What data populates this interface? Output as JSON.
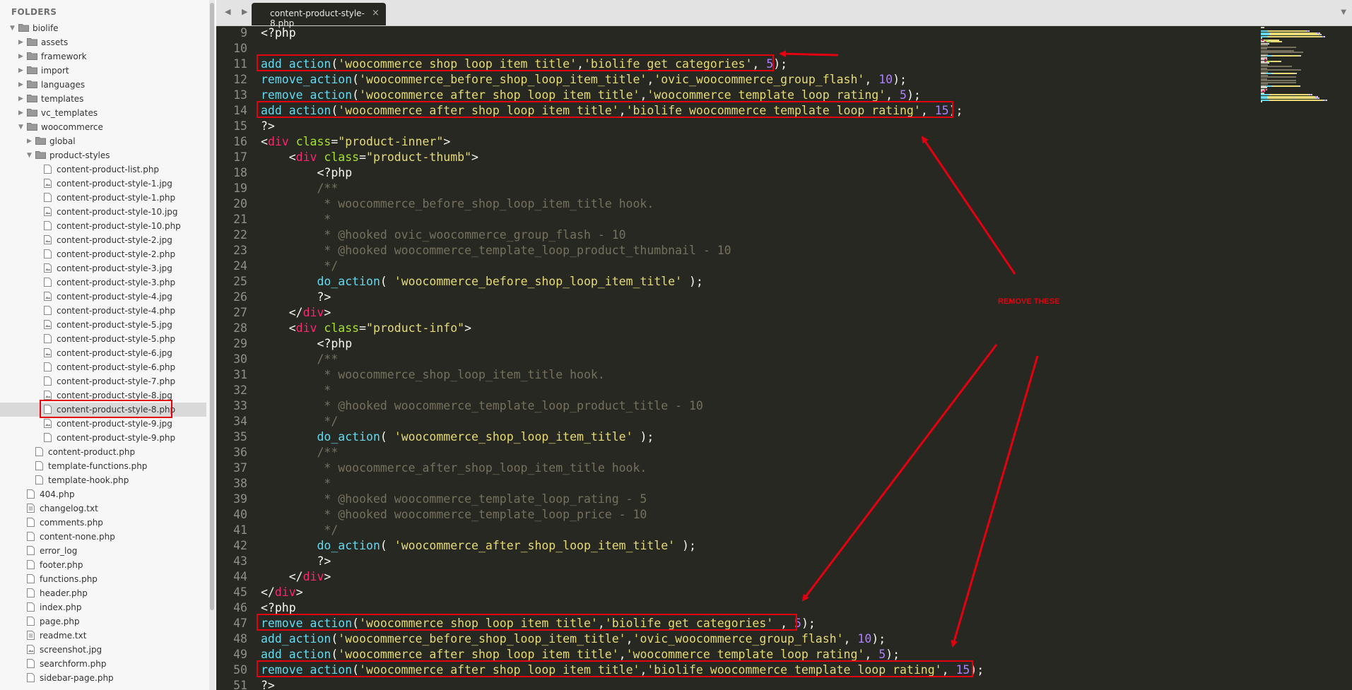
{
  "sidebar": {
    "header": "FOLDERS",
    "items": [
      {
        "label": "biolife",
        "type": "folder",
        "depth": 0,
        "expanded": true
      },
      {
        "label": "assets",
        "type": "folder",
        "depth": 1,
        "expanded": false
      },
      {
        "label": "framework",
        "type": "folder",
        "depth": 1,
        "expanded": false
      },
      {
        "label": "import",
        "type": "folder",
        "depth": 1,
        "expanded": false
      },
      {
        "label": "languages",
        "type": "folder",
        "depth": 1,
        "expanded": false
      },
      {
        "label": "templates",
        "type": "folder",
        "depth": 1,
        "expanded": false
      },
      {
        "label": "vc_templates",
        "type": "folder",
        "depth": 1,
        "expanded": false
      },
      {
        "label": "woocommerce",
        "type": "folder",
        "depth": 1,
        "expanded": true
      },
      {
        "label": "global",
        "type": "folder",
        "depth": 2,
        "expanded": false
      },
      {
        "label": "product-styles",
        "type": "folder",
        "depth": 2,
        "expanded": true
      },
      {
        "label": "content-product-list.php",
        "type": "file",
        "depth": 3
      },
      {
        "label": "content-product-style-1.jpg",
        "type": "image",
        "depth": 3
      },
      {
        "label": "content-product-style-1.php",
        "type": "file",
        "depth": 3
      },
      {
        "label": "content-product-style-10.jpg",
        "type": "image",
        "depth": 3
      },
      {
        "label": "content-product-style-10.php",
        "type": "file",
        "depth": 3
      },
      {
        "label": "content-product-style-2.jpg",
        "type": "image",
        "depth": 3
      },
      {
        "label": "content-product-style-2.php",
        "type": "file",
        "depth": 3
      },
      {
        "label": "content-product-style-3.jpg",
        "type": "image",
        "depth": 3
      },
      {
        "label": "content-product-style-3.php",
        "type": "file",
        "depth": 3
      },
      {
        "label": "content-product-style-4.jpg",
        "type": "image",
        "depth": 3
      },
      {
        "label": "content-product-style-4.php",
        "type": "file",
        "depth": 3
      },
      {
        "label": "content-product-style-5.jpg",
        "type": "image",
        "depth": 3
      },
      {
        "label": "content-product-style-5.php",
        "type": "file",
        "depth": 3
      },
      {
        "label": "content-product-style-6.jpg",
        "type": "image",
        "depth": 3
      },
      {
        "label": "content-product-style-6.php",
        "type": "file",
        "depth": 3
      },
      {
        "label": "content-product-style-7.php",
        "type": "file",
        "depth": 3
      },
      {
        "label": "content-product-style-8.jpg",
        "type": "image",
        "depth": 3
      },
      {
        "label": "content-product-style-8.php",
        "type": "file",
        "depth": 3,
        "selected": true
      },
      {
        "label": "content-product-style-9.jpg",
        "type": "image",
        "depth": 3
      },
      {
        "label": "content-product-style-9.php",
        "type": "file",
        "depth": 3
      },
      {
        "label": "content-product.php",
        "type": "file",
        "depth": 2
      },
      {
        "label": "template-functions.php",
        "type": "file",
        "depth": 2
      },
      {
        "label": "template-hook.php",
        "type": "file",
        "depth": 2
      },
      {
        "label": "404.php",
        "type": "file",
        "depth": 1
      },
      {
        "label": "changelog.txt",
        "type": "text",
        "depth": 1
      },
      {
        "label": "comments.php",
        "type": "file",
        "depth": 1
      },
      {
        "label": "content-none.php",
        "type": "file",
        "depth": 1
      },
      {
        "label": "error_log",
        "type": "file",
        "depth": 1
      },
      {
        "label": "footer.php",
        "type": "file",
        "depth": 1
      },
      {
        "label": "functions.php",
        "type": "file",
        "depth": 1
      },
      {
        "label": "header.php",
        "type": "file",
        "depth": 1
      },
      {
        "label": "index.php",
        "type": "file",
        "depth": 1
      },
      {
        "label": "page.php",
        "type": "file",
        "depth": 1
      },
      {
        "label": "readme.txt",
        "type": "text",
        "depth": 1
      },
      {
        "label": "screenshot.jpg",
        "type": "image",
        "depth": 1
      },
      {
        "label": "searchform.php",
        "type": "file",
        "depth": 1
      },
      {
        "label": "sidebar-page.php",
        "type": "file",
        "depth": 1
      }
    ]
  },
  "editor": {
    "nav_arrows": "◀ ▶",
    "tab_title": "content-product-style-8.php",
    "tab_close": "×",
    "tab_menu": "▼",
    "lines": [
      {
        "n": "9",
        "s": [
          [
            "t-plain",
            "<?php"
          ]
        ]
      },
      {
        "n": "10",
        "s": []
      },
      {
        "n": "11",
        "s": [
          [
            "t-fn",
            "add_action"
          ],
          [
            "t-plain",
            "("
          ],
          [
            "t-str",
            "'woocommerce_shop_loop_item_title'"
          ],
          [
            "t-plain",
            ","
          ],
          [
            "t-str",
            "'biolife_get_categories'"
          ],
          [
            "t-plain",
            ", "
          ],
          [
            "t-num",
            "5"
          ],
          [
            "t-plain",
            ");"
          ]
        ]
      },
      {
        "n": "12",
        "s": [
          [
            "t-fn",
            "remove_action"
          ],
          [
            "t-plain",
            "("
          ],
          [
            "t-str",
            "'woocommerce_before_shop_loop_item_title'"
          ],
          [
            "t-plain",
            ","
          ],
          [
            "t-str",
            "'ovic_woocommerce_group_flash'"
          ],
          [
            "t-plain",
            ", "
          ],
          [
            "t-num",
            "10"
          ],
          [
            "t-plain",
            ");"
          ]
        ]
      },
      {
        "n": "13",
        "s": [
          [
            "t-fn",
            "remove_action"
          ],
          [
            "t-plain",
            "("
          ],
          [
            "t-str",
            "'woocommerce_after_shop_loop_item_title'"
          ],
          [
            "t-plain",
            ","
          ],
          [
            "t-str",
            "'woocommerce_template_loop_rating'"
          ],
          [
            "t-plain",
            ", "
          ],
          [
            "t-num",
            "5"
          ],
          [
            "t-plain",
            ");"
          ]
        ]
      },
      {
        "n": "14",
        "s": [
          [
            "t-fn",
            "add_action"
          ],
          [
            "t-plain",
            "("
          ],
          [
            "t-str",
            "'woocommerce_after_shop_loop_item_title'"
          ],
          [
            "t-plain",
            ","
          ],
          [
            "t-str",
            "'biolife_woocommerce_template_loop_rating'"
          ],
          [
            "t-plain",
            ", "
          ],
          [
            "t-num",
            "15"
          ],
          [
            "t-plain",
            ");"
          ]
        ]
      },
      {
        "n": "15",
        "s": [
          [
            "t-plain",
            "?>"
          ]
        ]
      },
      {
        "n": "16",
        "s": [
          [
            "t-plain",
            "<"
          ],
          [
            "t-tag",
            "div"
          ],
          [
            "t-plain",
            " "
          ],
          [
            "t-attr",
            "class"
          ],
          [
            "t-plain",
            "="
          ],
          [
            "t-str",
            "\"product-inner\""
          ],
          [
            "t-plain",
            ">"
          ]
        ]
      },
      {
        "n": "17",
        "s": [
          [
            "t-plain",
            "    <"
          ],
          [
            "t-tag",
            "div"
          ],
          [
            "t-plain",
            " "
          ],
          [
            "t-attr",
            "class"
          ],
          [
            "t-plain",
            "="
          ],
          [
            "t-str",
            "\"product-thumb\""
          ],
          [
            "t-plain",
            ">"
          ]
        ]
      },
      {
        "n": "18",
        "s": [
          [
            "t-plain",
            "        <?php"
          ]
        ]
      },
      {
        "n": "19",
        "s": [
          [
            "t-cmt",
            "        /**"
          ]
        ]
      },
      {
        "n": "20",
        "s": [
          [
            "t-cmt",
            "         * woocommerce_before_shop_loop_item_title hook."
          ]
        ]
      },
      {
        "n": "21",
        "s": [
          [
            "t-cmt",
            "         *"
          ]
        ]
      },
      {
        "n": "22",
        "s": [
          [
            "t-cmt",
            "         * @hooked ovic_woocommerce_group_flash - 10"
          ]
        ]
      },
      {
        "n": "23",
        "s": [
          [
            "t-cmt",
            "         * @hooked woocommerce_template_loop_product_thumbnail - 10"
          ]
        ]
      },
      {
        "n": "24",
        "s": [
          [
            "t-cmt",
            "         */"
          ]
        ]
      },
      {
        "n": "25",
        "s": [
          [
            "t-plain",
            "        "
          ],
          [
            "t-fn",
            "do_action"
          ],
          [
            "t-plain",
            "( "
          ],
          [
            "t-str",
            "'woocommerce_before_shop_loop_item_title'"
          ],
          [
            "t-plain",
            " );"
          ]
        ]
      },
      {
        "n": "26",
        "s": [
          [
            "t-plain",
            "        ?>"
          ]
        ]
      },
      {
        "n": "27",
        "s": [
          [
            "t-plain",
            "    </"
          ],
          [
            "t-tag",
            "div"
          ],
          [
            "t-plain",
            ">"
          ]
        ]
      },
      {
        "n": "28",
        "s": [
          [
            "t-plain",
            "    <"
          ],
          [
            "t-tag",
            "div"
          ],
          [
            "t-plain",
            " "
          ],
          [
            "t-attr",
            "class"
          ],
          [
            "t-plain",
            "="
          ],
          [
            "t-str",
            "\"product-info\""
          ],
          [
            "t-plain",
            ">"
          ]
        ]
      },
      {
        "n": "29",
        "s": [
          [
            "t-plain",
            "        <?php"
          ]
        ]
      },
      {
        "n": "30",
        "s": [
          [
            "t-cmt",
            "        /**"
          ]
        ]
      },
      {
        "n": "31",
        "s": [
          [
            "t-cmt",
            "         * woocommerce_shop_loop_item_title hook."
          ]
        ]
      },
      {
        "n": "32",
        "s": [
          [
            "t-cmt",
            "         *"
          ]
        ]
      },
      {
        "n": "33",
        "s": [
          [
            "t-cmt",
            "         * @hooked woocommerce_template_loop_product_title - 10"
          ]
        ]
      },
      {
        "n": "34",
        "s": [
          [
            "t-cmt",
            "         */"
          ]
        ]
      },
      {
        "n": "35",
        "s": [
          [
            "t-plain",
            "        "
          ],
          [
            "t-fn",
            "do_action"
          ],
          [
            "t-plain",
            "( "
          ],
          [
            "t-str",
            "'woocommerce_shop_loop_item_title'"
          ],
          [
            "t-plain",
            " );"
          ]
        ]
      },
      {
        "n": "36",
        "s": [
          [
            "t-cmt",
            "        /**"
          ]
        ]
      },
      {
        "n": "37",
        "s": [
          [
            "t-cmt",
            "         * woocommerce_after_shop_loop_item_title hook."
          ]
        ]
      },
      {
        "n": "38",
        "s": [
          [
            "t-cmt",
            "         *"
          ]
        ]
      },
      {
        "n": "39",
        "s": [
          [
            "t-cmt",
            "         * @hooked woocommerce_template_loop_rating - 5"
          ]
        ]
      },
      {
        "n": "40",
        "s": [
          [
            "t-cmt",
            "         * @hooked woocommerce_template_loop_price - 10"
          ]
        ]
      },
      {
        "n": "41",
        "s": [
          [
            "t-cmt",
            "         */"
          ]
        ]
      },
      {
        "n": "42",
        "s": [
          [
            "t-plain",
            "        "
          ],
          [
            "t-fn",
            "do_action"
          ],
          [
            "t-plain",
            "( "
          ],
          [
            "t-str",
            "'woocommerce_after_shop_loop_item_title'"
          ],
          [
            "t-plain",
            " );"
          ]
        ]
      },
      {
        "n": "43",
        "s": [
          [
            "t-plain",
            "        ?>"
          ]
        ]
      },
      {
        "n": "44",
        "s": [
          [
            "t-plain",
            "    </"
          ],
          [
            "t-tag",
            "div"
          ],
          [
            "t-plain",
            ">"
          ]
        ]
      },
      {
        "n": "45",
        "s": [
          [
            "t-plain",
            "</"
          ],
          [
            "t-tag",
            "div"
          ],
          [
            "t-plain",
            ">"
          ]
        ]
      },
      {
        "n": "46",
        "s": [
          [
            "t-plain",
            "<?php"
          ]
        ]
      },
      {
        "n": "47",
        "s": [
          [
            "t-fn",
            "remove_action"
          ],
          [
            "t-plain",
            "("
          ],
          [
            "t-str",
            "'woocommerce_shop_loop_item_title'"
          ],
          [
            "t-plain",
            ","
          ],
          [
            "t-str",
            "'biolife_get_categories'"
          ],
          [
            "t-plain",
            " , "
          ],
          [
            "t-num",
            "5"
          ],
          [
            "t-plain",
            ");"
          ]
        ]
      },
      {
        "n": "48",
        "s": [
          [
            "t-fn",
            "add_action"
          ],
          [
            "t-plain",
            "("
          ],
          [
            "t-str",
            "'woocommerce_before_shop_loop_item_title'"
          ],
          [
            "t-plain",
            ","
          ],
          [
            "t-str",
            "'ovic_woocommerce_group_flash'"
          ],
          [
            "t-plain",
            ", "
          ],
          [
            "t-num",
            "10"
          ],
          [
            "t-plain",
            ");"
          ]
        ]
      },
      {
        "n": "49",
        "s": [
          [
            "t-fn",
            "add_action"
          ],
          [
            "t-plain",
            "("
          ],
          [
            "t-str",
            "'woocommerce_after_shop_loop_item_title'"
          ],
          [
            "t-plain",
            ","
          ],
          [
            "t-str",
            "'woocommerce_template_loop_rating'"
          ],
          [
            "t-plain",
            ", "
          ],
          [
            "t-num",
            "5"
          ],
          [
            "t-plain",
            ");"
          ]
        ]
      },
      {
        "n": "50",
        "s": [
          [
            "t-fn",
            "remove_action"
          ],
          [
            "t-plain",
            "("
          ],
          [
            "t-str",
            "'woocommerce_after_shop_loop_item_title'"
          ],
          [
            "t-plain",
            ","
          ],
          [
            "t-str",
            "'biolife_woocommerce_template_loop_rating'"
          ],
          [
            "t-plain",
            ", "
          ],
          [
            "t-num",
            "15"
          ],
          [
            "t-plain",
            ");"
          ]
        ]
      },
      {
        "n": "51",
        "s": [
          [
            "t-plain",
            "?>"
          ]
        ]
      }
    ]
  },
  "annotation": {
    "label": "REMOVE THESE",
    "color": "#e3000f"
  },
  "theme": {
    "editor_bg": "#272822",
    "sidebar_bg": "#f7f7f7"
  }
}
